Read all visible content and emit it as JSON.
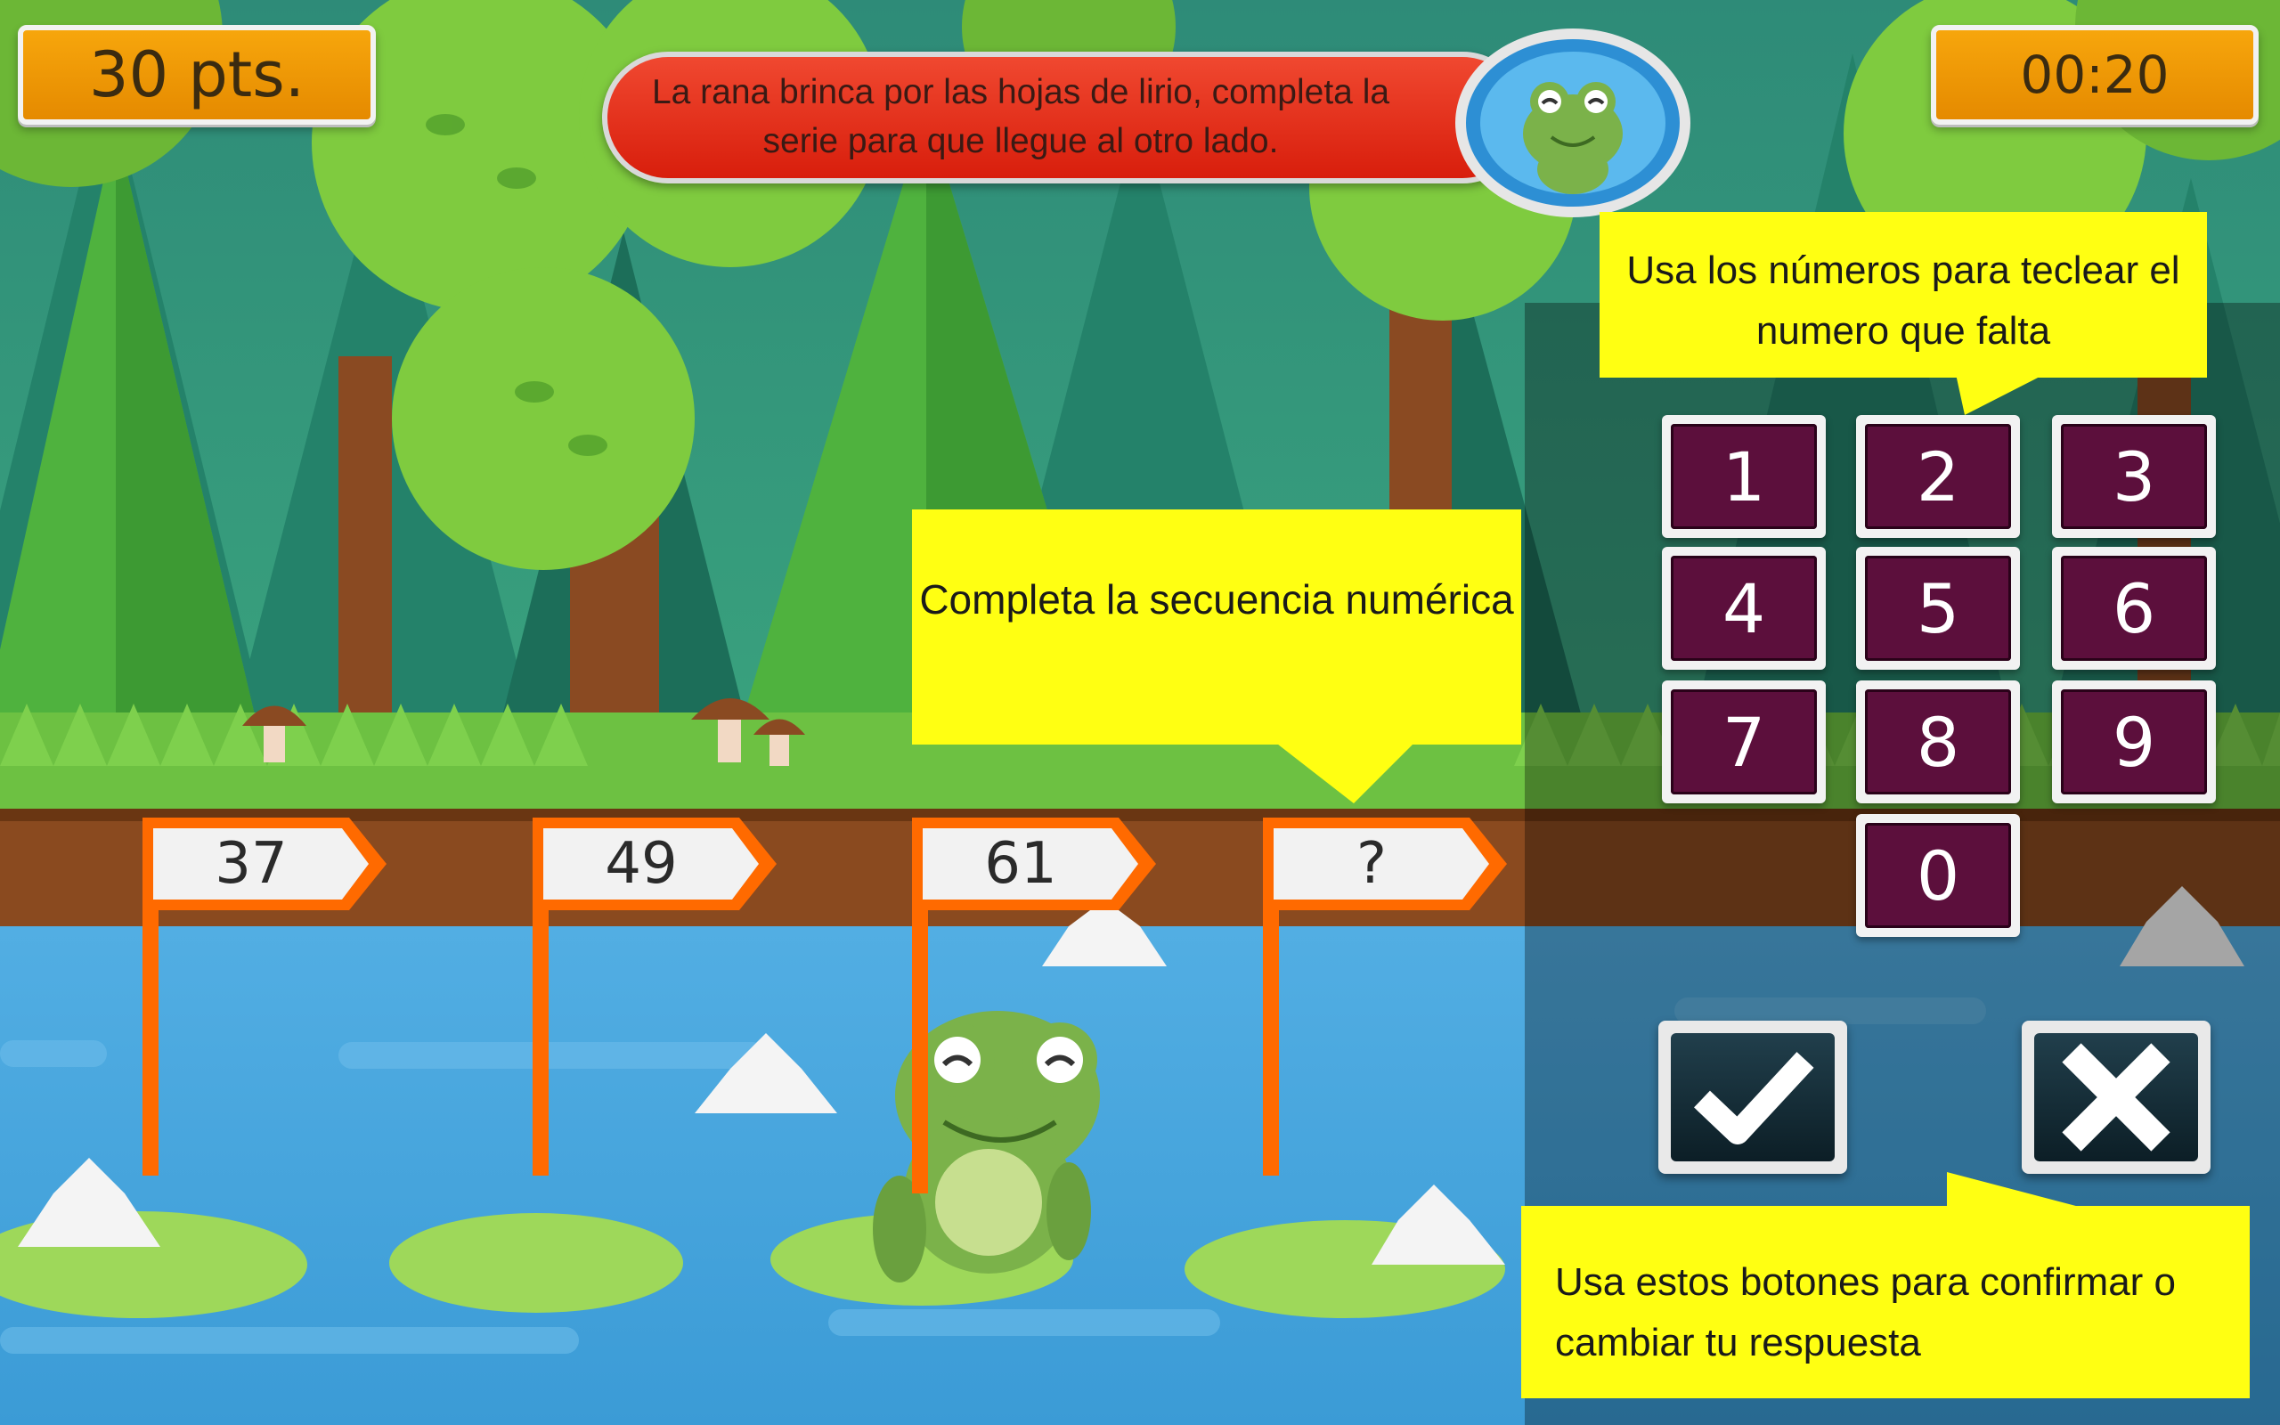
{
  "hud": {
    "score": "30 pts.",
    "timer": "00:20"
  },
  "instruction": {
    "text": "La rana brinca por las hojas de lirio, completa la serie para que llegue al otro lado."
  },
  "callouts": {
    "keypad": "Usa los números para teclear el numero que falta",
    "sequence": "Completa la secuencia numérica",
    "buttons": "Usa estos botones para confirmar o cambiar tu respuesta"
  },
  "sequence": [
    {
      "label": "37"
    },
    {
      "label": "49"
    },
    {
      "label": "61"
    },
    {
      "label": "?"
    }
  ],
  "keypad": {
    "keys": [
      "1",
      "2",
      "3",
      "4",
      "5",
      "6",
      "7",
      "8",
      "9",
      "0"
    ]
  },
  "actions": {
    "confirm_icon": "check-icon",
    "clear_icon": "x-icon"
  },
  "colors": {
    "sign_border": "#ff6a00",
    "key_face": "#5c0f3c",
    "callout": "#ffff12",
    "hud_box": "#f7a60c",
    "instruction_bar": "#e8331c"
  }
}
